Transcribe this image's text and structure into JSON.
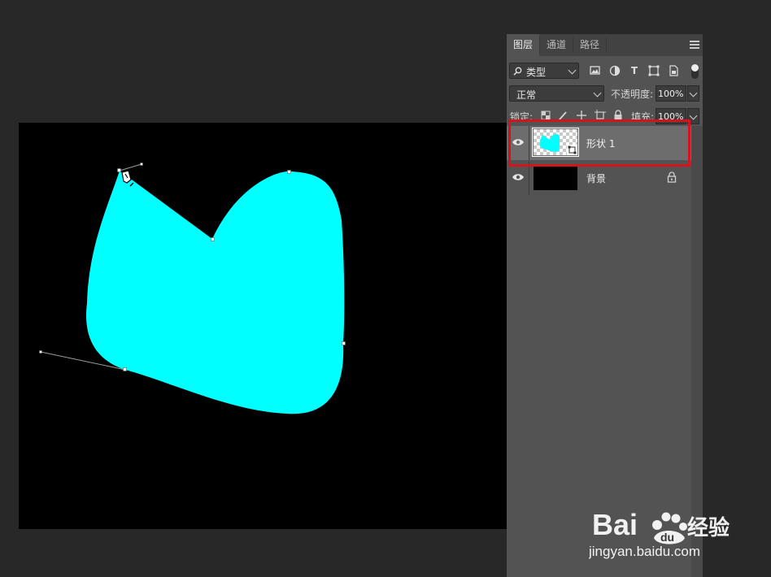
{
  "panel": {
    "tabs": [
      {
        "label": "图层",
        "active": true
      },
      {
        "label": "通道",
        "active": false
      },
      {
        "label": "路径",
        "active": false
      }
    ],
    "filter": {
      "icon": "search-icon",
      "value": "类型"
    },
    "blend_mode": "正常",
    "opacity_label": "不透明度:",
    "opacity_value": "100%",
    "lock_label": "锁定:",
    "fill_label": "填充:",
    "fill_value": "100%"
  },
  "layers": [
    {
      "name": "形状 1",
      "thumbnail": "cyan-shape",
      "selected": true,
      "visible": true
    },
    {
      "name": "背景",
      "thumbnail": "black-fill",
      "selected": false,
      "visible": true,
      "locked": true
    }
  ],
  "canvas": {
    "background": "#000000",
    "shape_color": "#00FFFF"
  },
  "watermark": {
    "brand": "Baidu经验",
    "url": "jingyan.baidu.com"
  },
  "colors": {
    "highlight": "#d4141a",
    "panel_bg": "#535353",
    "workspace_bg": "#282828"
  }
}
